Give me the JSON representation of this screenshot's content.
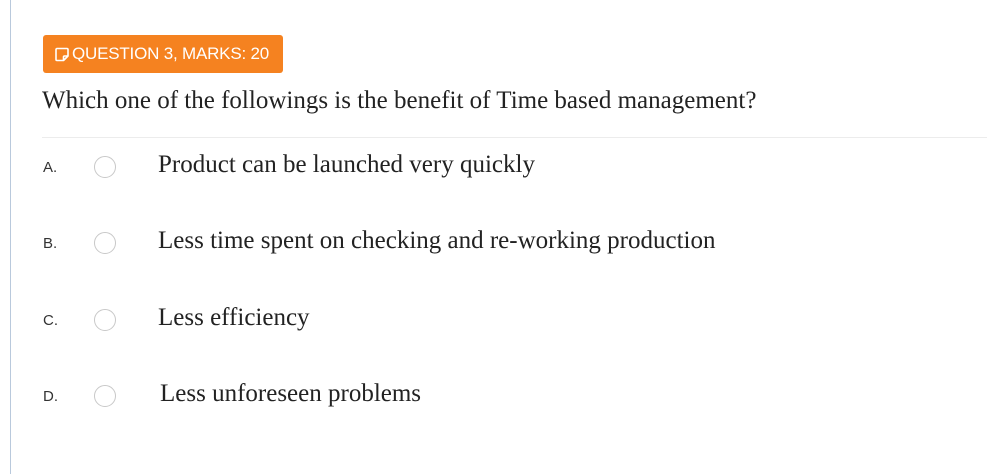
{
  "question": {
    "badge_label": "QUESTION 3, MARKS: 20",
    "badge_icon": "note-icon",
    "text": "Which one of the followings is the benefit of Time based management?",
    "accent_color": "#f58220"
  },
  "options": [
    {
      "letter": "A.",
      "text": "Product can be launched very quickly",
      "selected": false
    },
    {
      "letter": "B.",
      "text": "Less time spent on checking and re-working production",
      "selected": false
    },
    {
      "letter": "C.",
      "text": "Less efficiency",
      "selected": false
    },
    {
      "letter": "D.",
      "text": "Less unforeseen problems",
      "selected": false
    }
  ]
}
